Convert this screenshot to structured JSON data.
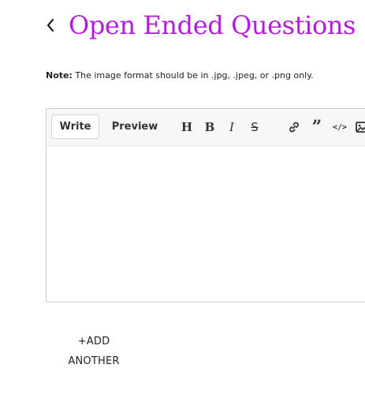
{
  "header": {
    "back_icon": "chevron-left-icon",
    "title": "Open Ended Questions",
    "title_color": "#b41ae0"
  },
  "note": {
    "label": "Note:",
    "text": "The image format should be in .jpg, .jpeg, or .png only."
  },
  "editor": {
    "tabs": [
      {
        "label": "Write",
        "active": true
      },
      {
        "label": "Preview",
        "active": false
      }
    ],
    "toolbar": {
      "heading": {
        "glyph": "H",
        "icon": "heading-icon"
      },
      "bold": {
        "glyph": "B",
        "icon": "bold-icon"
      },
      "italic": {
        "glyph": "I",
        "icon": "italic-icon"
      },
      "strikethrough": {
        "glyph": "S",
        "icon": "strikethrough-icon"
      },
      "link": {
        "icon": "link-icon"
      },
      "quote": {
        "glyph": "”",
        "icon": "quote-icon"
      },
      "code": {
        "glyph": "</>",
        "icon": "code-icon"
      },
      "image": {
        "icon": "image-icon"
      }
    },
    "value": ""
  },
  "add_another": {
    "line1": "+ADD",
    "line2": "ANOTHER"
  }
}
